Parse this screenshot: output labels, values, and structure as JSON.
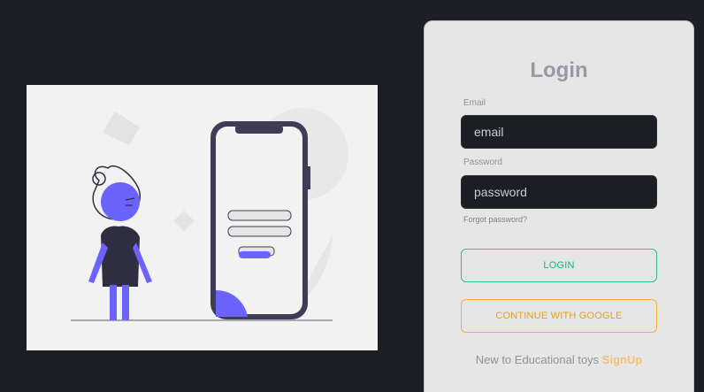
{
  "login": {
    "title": "Login",
    "email_label": "Email",
    "email_placeholder": "email",
    "password_label": "Password",
    "password_placeholder": "password",
    "forgot_password": "Forgot password?",
    "login_button": "LOGIN",
    "google_button": "CONTINUE WITH GOOGLE",
    "signup_prompt": "New to Educational toys",
    "signup_link": "SignUp"
  },
  "colors": {
    "page_background": "#1b1e22",
    "card_background": "#e6e6e6",
    "login_accent": "#2fbf88",
    "google_accent": "#f0b429",
    "signup_accent": "#f5c07a",
    "illustration_accent": "#6c63ff"
  },
  "illustration": {
    "description_icon": "login-illustration"
  }
}
